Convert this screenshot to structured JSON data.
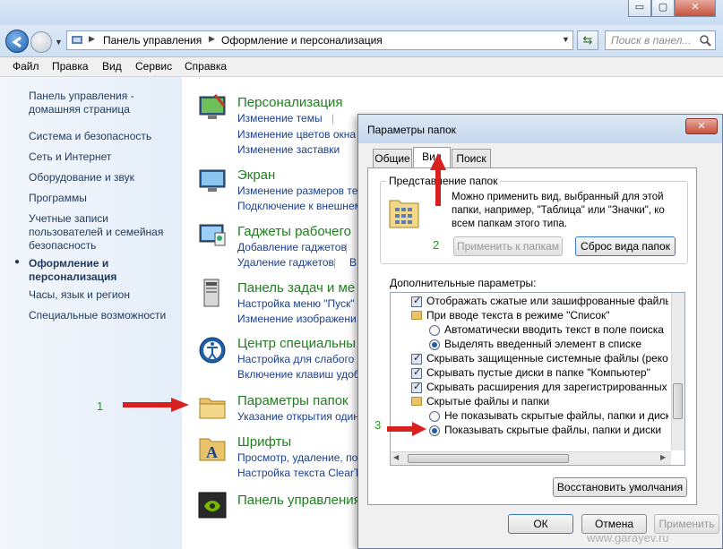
{
  "window": {
    "minimize_glyph": "▭",
    "maximize_glyph": "▢",
    "close_glyph": "✕"
  },
  "address": {
    "breadcrumb": [
      "Панель управления",
      "Оформление и персонализация"
    ],
    "search_placeholder": "Поиск в панел..."
  },
  "menu": [
    "Файл",
    "Правка",
    "Вид",
    "Сервис",
    "Справка"
  ],
  "sidebar": {
    "items": [
      {
        "label": "Панель управления - домашняя страница"
      },
      {
        "label": "Система и безопасность"
      },
      {
        "label": "Сеть и Интернет"
      },
      {
        "label": "Оборудование и звук"
      },
      {
        "label": "Программы"
      },
      {
        "label": "Учетные записи пользователей и семейная безопасность"
      },
      {
        "label": "Оформление и персонализация",
        "active": true
      },
      {
        "label": "Часы, язык и регион"
      },
      {
        "label": "Специальные возможности"
      }
    ]
  },
  "categories": [
    {
      "title": "Персонализация",
      "links": [
        "Изменение темы",
        "Изменение цветов окна",
        "Изменение заставки"
      ]
    },
    {
      "title": "Экран",
      "links": [
        "Изменение размеров тек",
        "Подключение к внешнем"
      ]
    },
    {
      "title": "Гаджеты рабочего",
      "links": [
        "Добавление гаджетов",
        "Удаление гаджетов"
      ]
    },
    {
      "title": "Панель задач и ме",
      "links": [
        "Настройка меню \"Пуск\"",
        "Изменение изображени"
      ]
    },
    {
      "title": "Центр специальны",
      "links": [
        "Настройка для слабого з",
        "Включение клавиш удоб"
      ]
    },
    {
      "title": "Параметры папок",
      "links": [
        "Указание открытия один"
      ]
    },
    {
      "title": "Шрифты",
      "links": [
        "Просмотр, удаление, пок",
        "Настройка текста ClearTy"
      ]
    },
    {
      "title": "Панель управления",
      "links": []
    }
  ],
  "annotations": {
    "one": "1",
    "two": "2",
    "three": "3"
  },
  "dialog": {
    "title": "Параметры папок",
    "tabs": [
      "Общие",
      "Вид",
      "Поиск"
    ],
    "group_view": "Представление папок",
    "view_text": "Можно применить вид, выбранный для этой папки, например, \"Таблица\" или \"Значки\", ко всем папкам этого типа.",
    "apply_button": "Применить к папкам",
    "reset_button": "Сброс вида папок",
    "advanced_label": "Дополнительные параметры:",
    "tree": [
      {
        "type": "check",
        "on": true,
        "indent": 0,
        "label": "Отображать сжатые или зашифрованные файлы NTI"
      },
      {
        "type": "folder",
        "indent": 0,
        "label": "При вводе текста в режиме \"Список\""
      },
      {
        "type": "radio",
        "on": false,
        "indent": 1,
        "label": "Автоматически вводить текст в поле поиска"
      },
      {
        "type": "radio",
        "on": true,
        "indent": 1,
        "label": "Выделять введенный элемент в списке"
      },
      {
        "type": "check",
        "on": true,
        "indent": 0,
        "label": "Скрывать защищенные системные файлы (рекомен"
      },
      {
        "type": "check",
        "on": true,
        "indent": 0,
        "label": "Скрывать пустые диски в папке \"Компьютер\""
      },
      {
        "type": "check",
        "on": true,
        "indent": 0,
        "label": "Скрывать расширения для зарегистрированных типо"
      },
      {
        "type": "folder",
        "indent": 0,
        "label": "Скрытые файлы и папки"
      },
      {
        "type": "radio",
        "on": false,
        "indent": 1,
        "label": "Не показывать скрытые файлы, папки и диски"
      },
      {
        "type": "radio",
        "on": true,
        "indent": 1,
        "label": "Показывать скрытые файлы, папки и диски"
      }
    ],
    "restore_button": "Восстановить умолчания",
    "ok_button": "ОК",
    "cancel_button": "Отмена",
    "apply_main_button": "Применить"
  },
  "watermark": "www.garayev.ru",
  "colors": {
    "category_title": "#1e7f1e",
    "link": "#1a3f8f",
    "arrow": "#d82020",
    "annotation": "#1aa01a"
  }
}
